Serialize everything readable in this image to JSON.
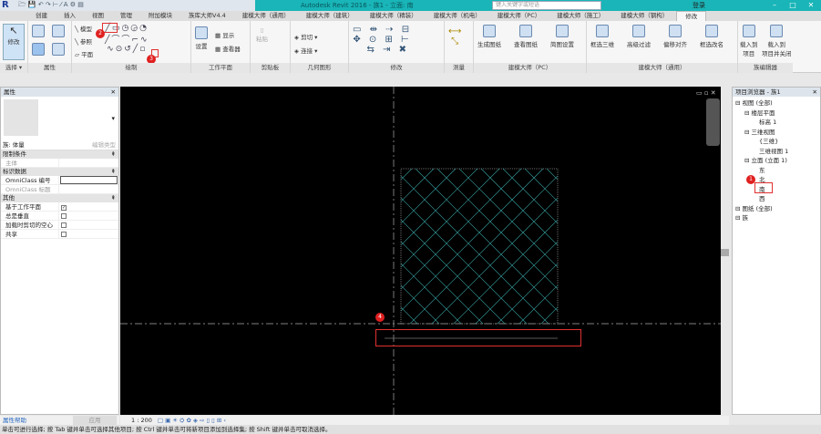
{
  "titlebar": {
    "title": "Autodesk Revit 2016 -   族1 - 立面: 南",
    "search_placeholder": "键入关键字或短语",
    "user": "登录"
  },
  "tabs": [
    "创建",
    "插入",
    "视图",
    "管理",
    "附加模块",
    "族库大师V4.4",
    "建模大师（通用）",
    "建模大师（建筑）",
    "建模大师（精装）",
    "建模大师（机电）",
    "建模大师（PC）",
    "建模大师（施工）",
    "建模大师（钢构）",
    "修改"
  ],
  "active_tab": "修改",
  "ribbon": {
    "modify": "修改",
    "panel_select": "选择 ▾",
    "panel_props": "属性",
    "draw_model": "模型",
    "draw_ref": "参照",
    "draw_plane": "平面",
    "panel_draw": "绘制",
    "wp_set": "设置",
    "wp_show": "显示",
    "wp_viewer": "查看器",
    "panel_wp": "工作平面",
    "paste": "粘贴",
    "panel_clipboard": "剪贴板",
    "cut": "剪切",
    "join": "连接",
    "panel_geometry": "几何图形",
    "panel_modify": "修改",
    "panel_measure": "测量",
    "pc_gen": "生成图纸",
    "pc_view": "查看图纸",
    "pc_set": "简图设置",
    "panel_pc": "建模大师（PC）",
    "g_box3d": "框选三维",
    "g_filter": "高级过滤",
    "g_align": "偏移对齐",
    "g_rename": "框选改名",
    "panel_general": "建模大师（通用）",
    "load_project": "载入到\n项目",
    "load_close": "载入到\n项目并关闭",
    "panel_family": "族编辑器"
  },
  "badges": {
    "b1": "1",
    "b2": "2",
    "b3": "3",
    "b4": "4"
  },
  "properties": {
    "title": "属性",
    "type": "族: 体量",
    "edit_type": "编辑类型",
    "sections": [
      {
        "name": "限制条件",
        "rows": [
          {
            "k": "主体",
            "v": ""
          }
        ]
      },
      {
        "name": "标识数据",
        "rows": [
          {
            "k": "OmniClass 编号",
            "v": ""
          },
          {
            "k": "OmniClass 标题",
            "v": ""
          }
        ]
      },
      {
        "name": "其他",
        "rows": [
          {
            "k": "基于工作平面",
            "check": true
          },
          {
            "k": "总是垂直",
            "check": false
          },
          {
            "k": "加载时剪切的空心",
            "check": false
          },
          {
            "k": "共享",
            "check": false
          }
        ]
      }
    ],
    "help": "属性帮助",
    "apply": "应用"
  },
  "browser": {
    "title": "项目浏览器 - 族1",
    "items": [
      {
        "t": "视图 (全部)",
        "lvl": 0
      },
      {
        "t": "楼层平面",
        "lvl": 1
      },
      {
        "t": "标高 1",
        "lvl": 2
      },
      {
        "t": "三维视图",
        "lvl": 1
      },
      {
        "t": "{三维}",
        "lvl": 2
      },
      {
        "t": "三维视图 1",
        "lvl": 2
      },
      {
        "t": "立面 (立面 1)",
        "lvl": 1
      },
      {
        "t": "东",
        "lvl": 2
      },
      {
        "t": "北",
        "lvl": 2
      },
      {
        "t": "南",
        "lvl": 2
      },
      {
        "t": "西",
        "lvl": 2
      },
      {
        "t": "图纸 (全部)",
        "lvl": 0
      },
      {
        "t": "族",
        "lvl": 0
      }
    ]
  },
  "viewbar": {
    "scale": "1 : 200"
  },
  "status": "单击可进行选择; 按 Tab 键并单击可选择其他项目; 按 Ctrl 键并单击可将新项目添加到选择集; 按 Shift 键并单击可取消选择。",
  "colors": {
    "accent": "#19b5b8",
    "highlight": "#e03030"
  }
}
